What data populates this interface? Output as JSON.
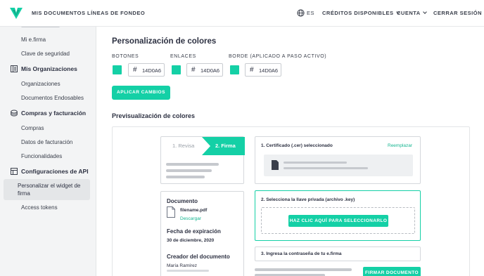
{
  "header": {
    "nav": [
      "MIS DOCUMENTOS",
      "LÍNEAS DE FONDEO"
    ],
    "lang": "ES",
    "creditos": "CRÉDITOS DISPONIBLES",
    "cuenta": "CUENTA",
    "logout": "CERRAR SESIÓN"
  },
  "sidebar": {
    "top_items": [
      "Mi e.firma",
      "Clave de seguridad"
    ],
    "organizaciones": {
      "title": "Mis Organizaciones",
      "items": [
        "Organizaciones",
        "Documentos Endosables"
      ]
    },
    "compras": {
      "title": "Compras y facturación",
      "items": [
        "Compras",
        "Datos de facturación",
        "Funcionalidades"
      ]
    },
    "api": {
      "title": "Configuraciones de API",
      "active_item": "Personalizar el widget de firma",
      "items": [
        "Access tokens"
      ]
    }
  },
  "main": {
    "title": "Personalización de colores",
    "fields": [
      {
        "label": "BOTONES",
        "hex": "14D0A6",
        "color": "#14d0a6"
      },
      {
        "label": "ENLACES",
        "hex": "14D0A6",
        "color": "#14d0a6"
      },
      {
        "label": "BORDE (APLICADO A PASO ACTIVO)",
        "hex": "14D0A6",
        "color": "#14d0a6"
      }
    ],
    "apply_button": "APLICAR CAMBIOS",
    "preview_title": "Previsualización de colores"
  },
  "preview": {
    "step1": "1. Revisa",
    "step2": "2. Firma",
    "doc_heading": "Documento",
    "filename": "filename.pdf",
    "download": "Descargar",
    "expiry_heading": "Fecha de expiración",
    "expiry_date": "30 de diciembre, 2020",
    "creator_heading": "Creador del documento",
    "creator_name": "María Ramírez",
    "cert_title": "1. Certificado (.cer) seleccionado",
    "replace": "Reemplazar",
    "key_title": "2. Selecciona la llave privada (archivo .key)",
    "select_button": "HAZ CLIC AQUÍ PARA SELECCIONARLO",
    "password_title": "3. Ingresa la contraseña de tu e.firma",
    "sign_button": "FIRMAR DOCUMENTO"
  },
  "colors": {
    "accent": "#14d0a6"
  }
}
